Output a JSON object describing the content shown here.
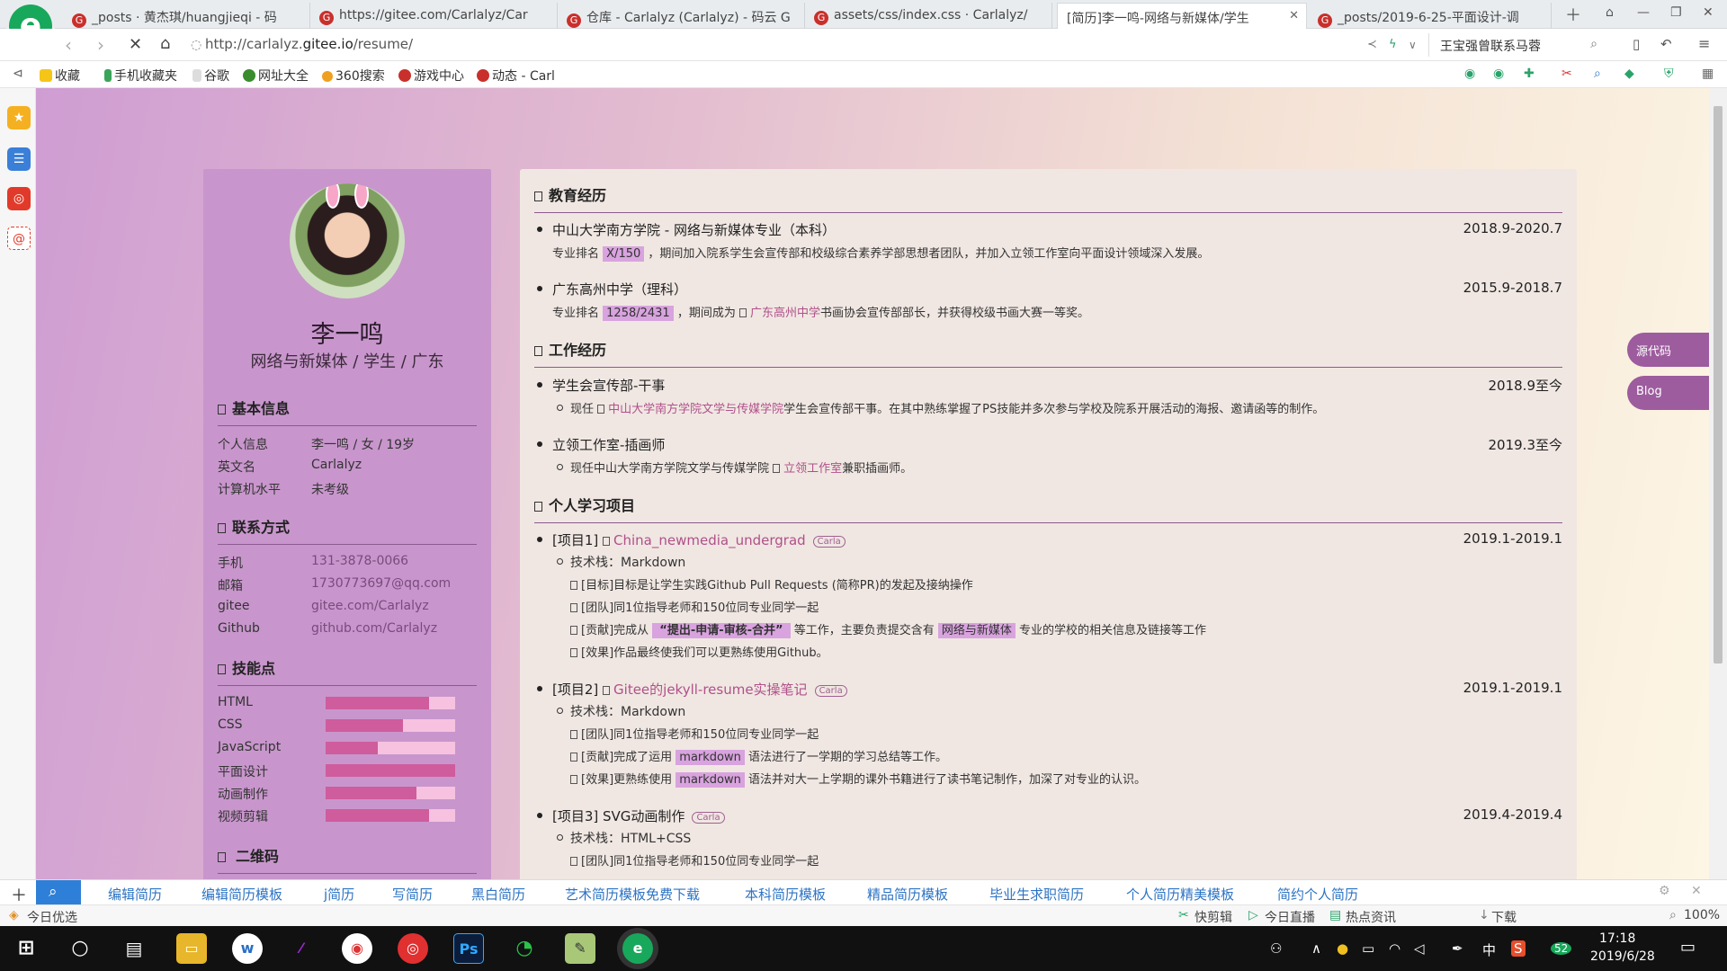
{
  "browser": {
    "tabs": [
      {
        "label": "_posts · 黄杰琪/huangjieqi - 码"
      },
      {
        "label": "https://gitee.com/Carlalyz/Car"
      },
      {
        "label": "仓库 - Carlalyz (Carlalyz) - 码云 G"
      },
      {
        "label": "assets/css/index.css · Carlalyz/"
      },
      {
        "label": "[简历]李一鸣-网络与新媒体/学生"
      },
      {
        "label": "_posts/2019-6-25-平面设计-调"
      }
    ],
    "url_prefix": "http://carlalyz.",
    "url_domain": "gitee.io",
    "url_path": "/resume/",
    "search_text": "王宝强曾联系马蓉",
    "bookmarks": [
      "收藏",
      "手机收藏夹",
      "谷歌",
      "网址大全",
      "360搜索",
      "游戏中心",
      "动态 - Carl"
    ]
  },
  "resume": {
    "name": "李一鸣",
    "subtitle": "网络与新媒体 / 学生 / 广东",
    "basic": {
      "heading": "基本信息",
      "rows": [
        {
          "k": "个人信息",
          "v": "李一鸣 / 女 / 19岁"
        },
        {
          "k": "英文名",
          "v": "Carlalyz"
        },
        {
          "k": "计算机水平",
          "v": "未考级"
        }
      ]
    },
    "contact": {
      "heading": "联系方式",
      "rows": [
        {
          "k": "手机",
          "v": "131-3878-0066"
        },
        {
          "k": "邮箱",
          "v": "1730773697@qq.com"
        },
        {
          "k": "gitee",
          "v": "gitee.com/Carlalyz"
        },
        {
          "k": "Github",
          "v": "github.com/Carlalyz"
        }
      ]
    },
    "skills": {
      "heading": "技能点",
      "items": [
        {
          "name": "HTML",
          "level": 0.8
        },
        {
          "name": "CSS",
          "level": 0.6
        },
        {
          "name": "JavaScript",
          "level": 0.4
        },
        {
          "name": "平面设计",
          "level": 1.0
        },
        {
          "name": "动画制作",
          "level": 0.7
        },
        {
          "name": "视频剪辑",
          "level": 0.8
        }
      ]
    },
    "qr_heading": "二维码",
    "education": {
      "heading": "教育经历",
      "items": [
        {
          "title": "中山大学南方学院 - 网络与新媒体专业（本科）",
          "date": "2018.9-2020.7",
          "d1": "专业排名",
          "rank": "X/150",
          "d2": "，期间加入院系学生会宣传部和校级综合素养学部思想者团队，并加入立领工作室向平面设计领域深入发展。"
        },
        {
          "title": "广东高州中学（理科）",
          "date": "2015.9-2018.7",
          "d1": "专业排名",
          "rank": "1258/2431",
          "d2": "，期间成为",
          "link": "广东高州中学",
          "d3": "书画协会宣传部部长，并获得校级书画大赛一等奖。"
        }
      ]
    },
    "work": {
      "heading": "工作经历",
      "items": [
        {
          "title": "学生会宣传部-干事",
          "date": "2018.9至今",
          "d1": "现任",
          "link": "中山大学南方学院文学与传媒学院",
          "d2": "学生会宣传部干事。在其中熟练掌握了PS技能并多次参与学校及院系开展活动的海报、邀请函等的制作。"
        },
        {
          "title": "立领工作室-插画师",
          "date": "2019.3至今",
          "d1": "现任中山大学南方学院文学与传媒学院",
          "link": "立领工作室",
          "d2": "兼职插画师。"
        }
      ]
    },
    "projects": {
      "heading": "个人学习项目",
      "tag": "Carla",
      "p1": {
        "prefix": "[项目1]",
        "link": "China_newmedia_undergrad",
        "date": "2019.1-2019.1",
        "tech": "技术栈：Markdown",
        "goal": "[目标]目标是让学生实践Github Pull Requests (简称PR)的发起及接纳操作",
        "team": "[团队]同1位指导老师和150位同专业同学一起",
        "c1": "[贡献]完成从",
        "c2": "“提出-申请-审核-合并”",
        "c3": "等工作，主要负责提交含有",
        "c4": "网络与新媒体",
        "c5": "专业的学校的相关信息及链接等工作",
        "effect": "[效果]作品最终使我们可以更熟练使用Github。"
      },
      "p2": {
        "prefix": "[项目2]",
        "link": "Gitee的jekyll-resume实操笔记",
        "date": "2019.1-2019.1",
        "tech": "技术栈：Markdown",
        "team": "[团队]同1位指导老师和150位同专业同学一起",
        "c1": "[贡献]完成了运用",
        "c2": "markdown",
        "c3": "语法进行了一学期的学习总结等工作。",
        "e1": "[效果]更熟练使用",
        "e2": "markdown",
        "e3": "语法并对大一上学期的课外书籍进行了读书笔记制作，加深了对专业的认识。"
      },
      "p3": {
        "title": "[项目3] SVG动画制作",
        "date": "2019.4-2019.4",
        "tech": "技术栈：HTML+CSS",
        "team": "[团队]同1位指导老师和150位同专业同学一起"
      }
    },
    "float_buttons": [
      "源代码",
      "Blog"
    ]
  },
  "bottom_links": [
    "编辑简历",
    "编辑简历模板",
    "j简历",
    "写简历",
    "黑白简历",
    "艺术简历模板免费下载",
    "本科简历模板",
    "精品简历模板",
    "毕业生求职简历",
    "个人简历精美模板",
    "简约个人简历"
  ],
  "status": {
    "left": "今日优选",
    "items": [
      "快剪辑",
      "今日直播",
      "热点资讯",
      "下载",
      "100%"
    ]
  },
  "taskbar": {
    "time": "17:18",
    "date": "2019/6/28",
    "ime": "中",
    "badge": "52"
  }
}
